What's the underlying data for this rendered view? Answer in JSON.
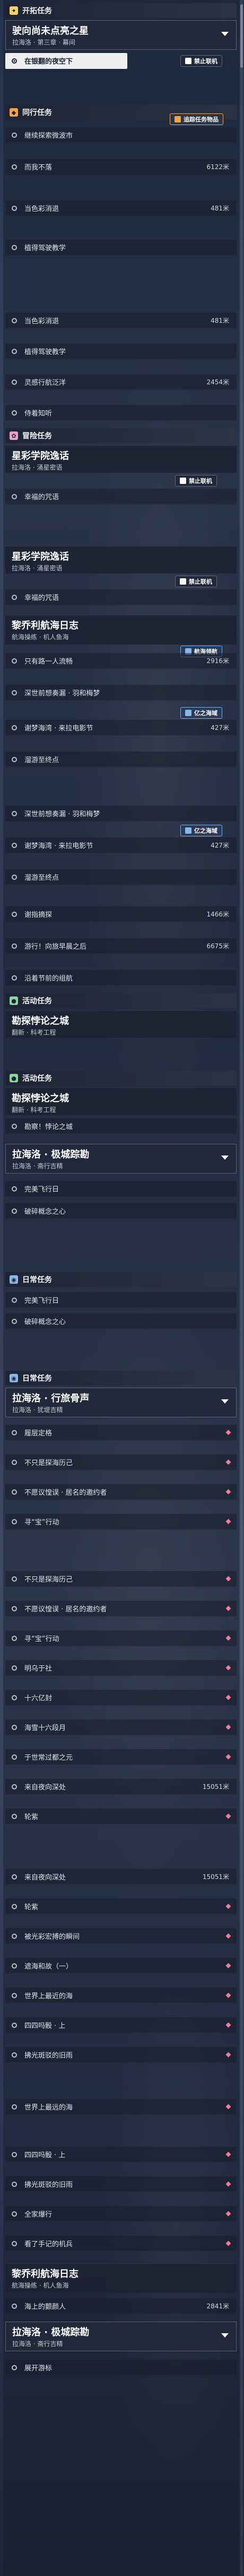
{
  "categories": {
    "trailblaze": "开拓任务",
    "companion": "同行任务",
    "adventure": "冒险任务",
    "event": "活动任务",
    "daily": "日常任务"
  },
  "badges": {
    "disabled_co_op": "禁止联机",
    "side_quest_items": "追踪任务物品",
    "nav_guide": "航海领航",
    "nav_plan": "亿之海域"
  },
  "groups": {
    "g1": {
      "title": "驶向尚未点亮之星",
      "sub": "拉海洛 · 第三章 · 幕间"
    },
    "g2": {
      "title": "星彩学院逸话",
      "sub": "拉海洛 · 涌星密语"
    },
    "g3": {
      "title": "星彩学院逸话",
      "sub": "拉海洛 · 涌星密语"
    },
    "g4": {
      "title": "黎乔利航海日志",
      "sub": "航海操练 · 机人鱼海"
    },
    "g5": {
      "title": "勘探悖论之城",
      "sub": "翻新 · 科考工程"
    },
    "g6": {
      "title": "勘探悖论之城",
      "sub": "翻新 · 科考工程"
    },
    "g7": {
      "title": "拉海洛 · 极城踪勘",
      "sub": "拉海洛 · 斋行吉精"
    },
    "g8": {
      "title": "拉海洛 · 行旅骨声",
      "sub": "拉海洛 · 犹堤吉精"
    },
    "g9": {
      "title": "黎乔利航海日志",
      "sub": "航海操练 · 机人鱼海"
    },
    "g10": {
      "title": "拉海洛 · 极城踪勘",
      "sub": "拉海洛 · 斋行吉精"
    }
  },
  "rows": {
    "r1": {
      "label": "在银翻的夜空下"
    },
    "r2": {
      "label": "继续探索微波市"
    },
    "r3": {
      "label": "而我不落",
      "dist": "6122米"
    },
    "r4": {
      "label": "当色彩消退",
      "dist": "481米"
    },
    "r5": {
      "label": "植得驾驶教学"
    },
    "r6": {
      "label": "当色彩消退",
      "dist": "481米"
    },
    "r7": {
      "label": "植得驾驶教学"
    },
    "r8": {
      "label": "灵感行航泛洋",
      "dist": "2454米"
    },
    "r9": {
      "label": "侍着知听"
    },
    "r10": {
      "label": "幸福的咒语"
    },
    "r11": {
      "label": "幸福的咒语"
    },
    "r12": {
      "label": "只有路一人流畅",
      "dist": "2916米"
    },
    "r13": {
      "label": "深世前想奏漏 · 羽和梅梦"
    },
    "r14": {
      "label": "谢梦海湾 · 来拉电影节",
      "dist": "427米"
    },
    "r15": {
      "label": "溜游至终点"
    },
    "r16": {
      "label": "深世前想奏漏 · 羽和梅梦"
    },
    "r17": {
      "label": "谢梦海湾 · 来拉电影节",
      "dist": "427米"
    },
    "r18": {
      "label": "溜游至终点"
    },
    "r19": {
      "label": "谢指摘探",
      "dist": "1466米"
    },
    "r20": {
      "label": "游行！向旅早晨之后",
      "dist": "6675米"
    },
    "r21": {
      "label": "沿着节前的组航"
    },
    "r22": {
      "label": "勘察！悖论之城"
    },
    "r23": {
      "label": "完美飞行日"
    },
    "r24": {
      "label": "破碎概念之心"
    },
    "r25": {
      "label": "完美飞行日"
    },
    "r26": {
      "label": "破碎概念之心"
    },
    "r27": {
      "label": "履层定格"
    },
    "r28": {
      "label": "不只是探海历己"
    },
    "r29": {
      "label": "不愿议惶误 · 居名的邀约者"
    },
    "r30": {
      "label": "寻“宝”行动"
    },
    "r31": {
      "label": "不只是探海历己"
    },
    "r32": {
      "label": "不愿议惶误 · 居名的邀约者"
    },
    "r33": {
      "label": "寻“宝”行动"
    },
    "r34": {
      "label": "明乌于社"
    },
    "r35": {
      "label": "十六亿封"
    },
    "r36": {
      "label": "海雪十六段月"
    },
    "r37": {
      "label": "于世常过都之元"
    },
    "r38": {
      "label": "来自夜向深处",
      "dist": "15051米"
    },
    "r39": {
      "label": "轮紫"
    },
    "r40": {
      "label": "来自夜向深处",
      "dist": "15051米"
    },
    "r41": {
      "label": "轮紫"
    },
    "r42": {
      "label": "被光彩宏搏的瞬间"
    },
    "r43": {
      "label": "遮海和故（一）"
    },
    "r44": {
      "label": "世界上最近的海"
    },
    "r45": {
      "label": "四四吗骰 · 上"
    },
    "r46": {
      "label": "拂光斑驳的旧雨"
    },
    "r47": {
      "label": "世界上最远的海"
    },
    "r48": {
      "label": "四四吗骰 · 上"
    },
    "r49": {
      "label": "拂光斑驳的旧雨"
    },
    "r50": {
      "label": "全家爆行"
    },
    "r51": {
      "label": "看了手记的机兵"
    },
    "r52": {
      "label": "海上的颤颜人",
      "dist": "2841米"
    },
    "r53": {
      "label": "展开游标"
    }
  }
}
